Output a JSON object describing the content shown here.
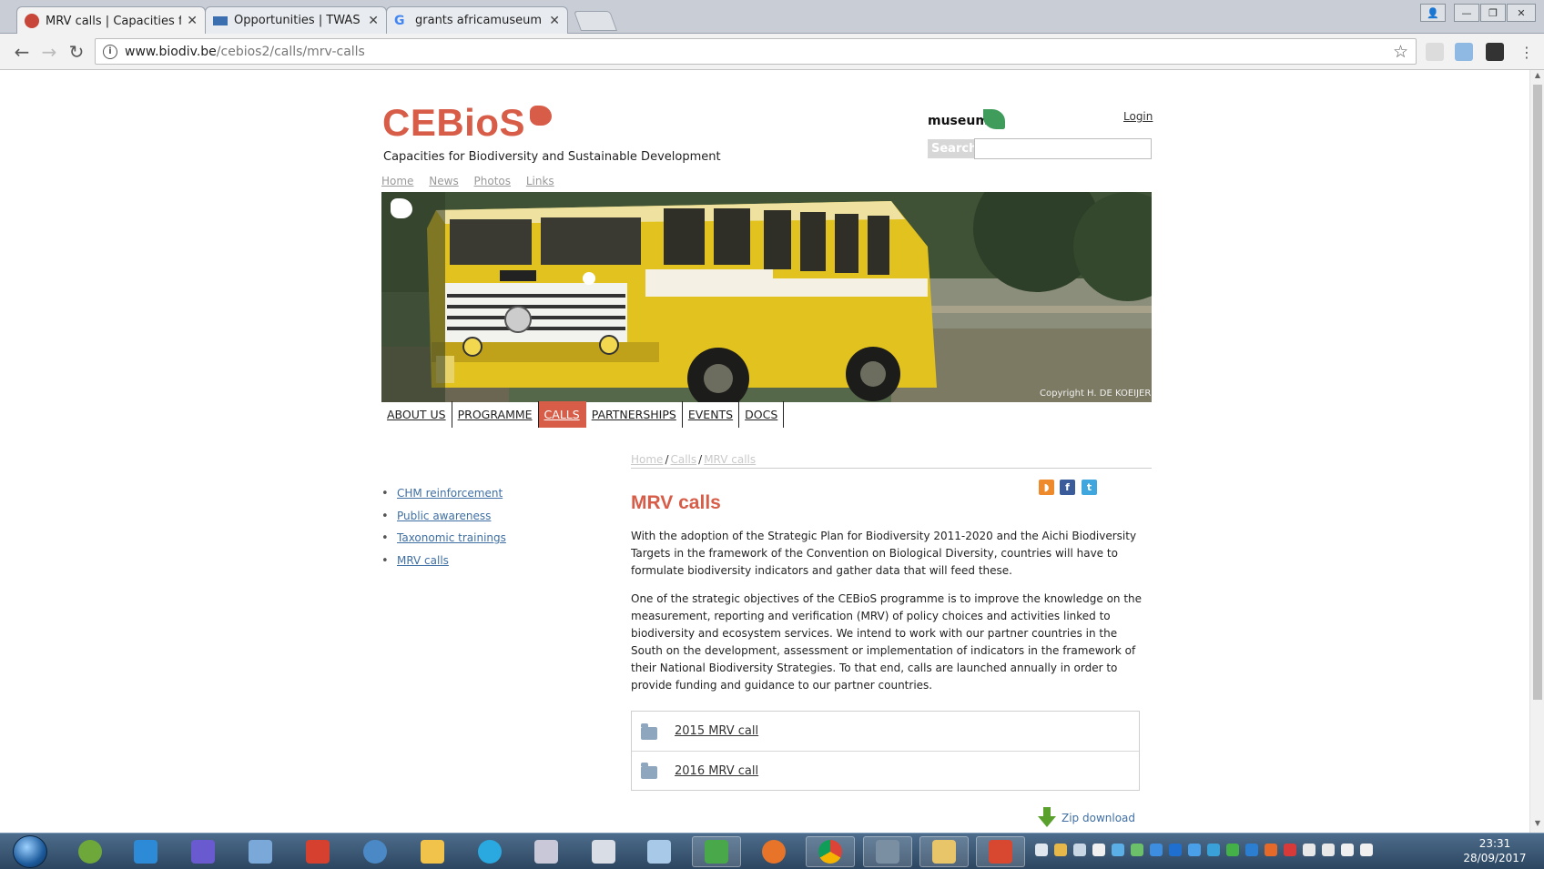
{
  "browser": {
    "tabs": [
      {
        "title": "MRV calls | Capacities fo"
      },
      {
        "title": "Opportunities | TWAS"
      },
      {
        "title": "grants africamuseum - G"
      }
    ],
    "url_domain": "www.biodiv.be",
    "url_path": "/cebios2/calls/mrv-calls"
  },
  "site": {
    "logo": "CEBioS",
    "tagline": "Capacities for Biodiversity and Sustainable Development",
    "museum_logo": "museum",
    "login": "Login",
    "search_label": "Search",
    "search_value": "",
    "top_links": [
      "Home",
      "News",
      "Photos",
      "Links"
    ],
    "hero_copyright": "Copyright H. DE KOEIJER",
    "main_nav": [
      {
        "label": "ABOUT US",
        "active": false
      },
      {
        "label": "PROGRAMME",
        "active": false
      },
      {
        "label": "CALLS",
        "active": true
      },
      {
        "label": "PARTNERSHIPS",
        "active": false
      },
      {
        "label": "EVENTS",
        "active": false
      },
      {
        "label": "DOCS",
        "active": false
      }
    ],
    "accent_color": "#d85d48"
  },
  "sidebar": {
    "items": [
      "CHM reinforcement",
      "Public awareness",
      "Taxonomic trainings",
      "MRV calls"
    ]
  },
  "content": {
    "breadcrumb": [
      "Home",
      "Calls",
      "MRV calls"
    ],
    "title": "MRV calls",
    "paragraph1": "With the adoption of the Strategic Plan for Biodiversity 2011-2020 and the Aichi Biodiversity Targets in the framework of the Convention on Biological Diversity, countries will have to formulate biodiversity indicators and gather data that will feed these.",
    "paragraph2": "One of the strategic objectives of the CEBioS programme is to improve the knowledge on the measurement, reporting and verification (MRV) of policy choices and activities linked to biodiversity and ecosystem services. We intend to work with our partner countries in the South on the development, assessment or implementation of indicators in the framework of their National Biodiversity Strategies. To that end, calls are launched annually in order to provide funding and guidance to our partner countries.",
    "files": [
      "2015 MRV call",
      "2016 MRV call"
    ],
    "zip_download": "Zip download"
  },
  "taskbar": {
    "time": "23:31",
    "date": "28/09/2017"
  }
}
